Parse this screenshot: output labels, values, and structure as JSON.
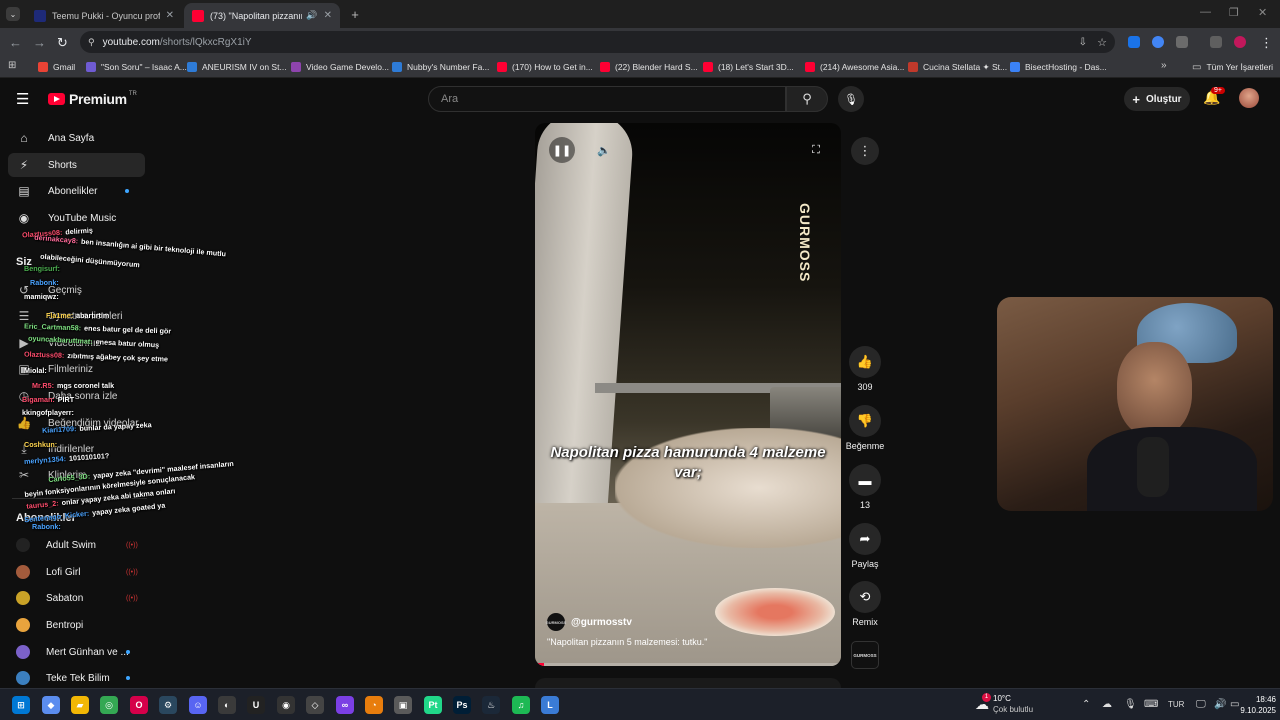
{
  "browser": {
    "tabs": [
      {
        "title": "Teemu Pukki - Oyuncu profili 2...",
        "active": false,
        "favicon_color": "#1e2a78"
      },
      {
        "title": "(73) \"Napolitan pizzanın 5 m...",
        "active": true,
        "favicon_color": "#ff0033"
      }
    ],
    "url_host": "youtube.com",
    "url_path": "/shorts/lQkxcRgX1iY",
    "new_tab": "+",
    "bookmarks": [
      {
        "label": "Gmail",
        "color": "#ea4335"
      },
      {
        "label": "\"Son Soru\" – Isaac A...",
        "color": "#6f5bd3"
      },
      {
        "label": "ANEURISM IV on St...",
        "color": "#2e7bd6"
      },
      {
        "label": "Video Game Develo...",
        "color": "#8e44ad"
      },
      {
        "label": "Nubby's Number Fa...",
        "color": "#2e7bd6"
      },
      {
        "label": "(170) How to Get in...",
        "color": "#ff0033"
      },
      {
        "label": "(22) Blender Hard S...",
        "color": "#ff0033"
      },
      {
        "label": "(18) Let's Start 3D...",
        "color": "#ff0033"
      },
      {
        "label": "(214) Awesome Asia...",
        "color": "#ff0033"
      },
      {
        "label": "Cucina Stellata ✦ St...",
        "color": "#c0392b"
      },
      {
        "label": "BisectHosting - Das...",
        "color": "#3b82f6"
      }
    ],
    "all_bookmarks": "Tüm Yer İşaretleri"
  },
  "masthead": {
    "brand": "Premium",
    "country": "TR",
    "search_placeholder": "Ara",
    "create_label": "Oluştur",
    "notif_count": "9+"
  },
  "sidebar": {
    "main": [
      {
        "label": "Ana Sayfa",
        "icon": "home-icon",
        "glyph": "⌂"
      },
      {
        "label": "Shorts",
        "icon": "shorts-icon",
        "glyph": "⚡"
      },
      {
        "label": "Abonelikler",
        "icon": "subscriptions-icon",
        "glyph": "▤"
      },
      {
        "label": "YouTube Music",
        "icon": "music-icon",
        "glyph": "◉"
      }
    ],
    "you_header": "Siz",
    "you": [
      {
        "label": "Geçmiş",
        "icon": "history-icon",
        "glyph": "↺"
      },
      {
        "label": "Oynatma listeleri",
        "icon": "playlist-icon",
        "glyph": "☰"
      },
      {
        "label": "Videolarınız",
        "icon": "your-videos-icon",
        "glyph": "▶"
      },
      {
        "label": "Filmleriniz",
        "icon": "movies-icon",
        "glyph": "▣"
      },
      {
        "label": "Daha sonra izle",
        "icon": "watch-later-icon",
        "glyph": "◷"
      },
      {
        "label": "Beğendiğim videolar",
        "icon": "liked-icon",
        "glyph": "👍"
      },
      {
        "label": "İndirilenler",
        "icon": "downloads-icon",
        "glyph": "⤓"
      },
      {
        "label": "Kliplerim",
        "icon": "clips-icon",
        "glyph": "✂"
      }
    ],
    "subs_header": "Abonelikler",
    "subscriptions": [
      {
        "label": "Adult Swim",
        "color": "#222222",
        "live": true,
        "dot": false
      },
      {
        "label": "Lofi Girl",
        "color": "#a35b3c",
        "live": true,
        "dot": false
      },
      {
        "label": "Sabaton",
        "color": "#c9a227",
        "live": true,
        "dot": false
      },
      {
        "label": "Bentropi",
        "color": "#e8a33d",
        "live": false,
        "dot": false
      },
      {
        "label": "Mert Günhan ve ...",
        "color": "#7b61c9",
        "live": false,
        "dot": true
      },
      {
        "label": "Teke Tek Bilim",
        "color": "#3b7fbf",
        "live": false,
        "dot": true
      }
    ]
  },
  "chat": [
    {
      "user": "Olaztuss08:",
      "msg": "delirmiş",
      "color": "#ff4d6d"
    },
    {
      "user": "derinakcay8:",
      "msg": "ben insanlığın ai gibi bir teknoloji ile mutlu",
      "color": "#ff6b9a"
    },
    {
      "user": "",
      "msg": "olabileceğini düşünmüyorum",
      "color": "#ffffff"
    },
    {
      "user": "Bengisurf:",
      "msg": "",
      "color": "#4caf50"
    },
    {
      "user": "Rabonk:",
      "msg": "",
      "color": "#4aa3ff"
    },
    {
      "user": "mamiqwz:",
      "msg": "",
      "color": "#ffffff"
    },
    {
      "user": "Fla1me:",
      "msg": "abartırtım",
      "color": "#ffd54f"
    },
    {
      "user": "Eric_Cartman58:",
      "msg": "enes batur gel de deli gör",
      "color": "#7ee081"
    },
    {
      "user": "oyuncakbaruttmat:",
      "msg": "enesa batur olmuş",
      "color": "#7ee081"
    },
    {
      "user": "Olaztuss08:",
      "msg": "zıbıtmış ağabey çok şey etme",
      "color": "#ff4d6d"
    },
    {
      "user": "Miolal:",
      "msg": "",
      "color": "#ffffff"
    },
    {
      "user": "Mr.R5:",
      "msg": "mgs coronel talk",
      "color": "#ff4d6d"
    },
    {
      "user": "Bigaman:",
      "msg": "PİRT",
      "color": "#ff4d6d"
    },
    {
      "user": "kkingofplayerr:",
      "msg": "",
      "color": "#ffffff"
    },
    {
      "user": "Kiari1709:",
      "msg": "bunlar da yapay zeka",
      "color": "#4aa3ff"
    },
    {
      "user": "Coshkun:",
      "msg": "",
      "color": "#ffd54f"
    },
    {
      "user": "merlyn1354:",
      "msg": "101010101?",
      "color": "#4aa3ff"
    },
    {
      "user": "Carlo55_3D:",
      "msg": "yapay zeka \"devrimi\" maalesef insanların",
      "color": "#7ee081"
    },
    {
      "user": "",
      "msg": "beyin fonksiyonlarının körelmesiyle sonuçlanacak",
      "color": "#ffffff"
    },
    {
      "user": "taurus_2:",
      "msg": "onlar yapay zeka abi takma onları",
      "color": "#ff4d6d"
    },
    {
      "user": "Sentenago_Kicker:",
      "msg": "yapay zeka goated ya",
      "color": "#4aa3ff"
    },
    {
      "user": "Rabonk:",
      "msg": "",
      "color": "#4aa3ff"
    }
  ],
  "short": {
    "brand_mark": "GURMOSS",
    "caption": "Napolitan pizza hamurunda 4 malzeme var;",
    "channel": "@gurmosstv",
    "channel_avatar_text": "GURMOSS",
    "title": "\"Napolitan pizzanın 5 malzemesi: tutku.\"",
    "progress": 0.03
  },
  "actions": {
    "likes": "309",
    "dislike": "Beğenme",
    "comments": "13",
    "share": "Paylaş",
    "remix": "Remix",
    "sound_thumb": "GURMOSS"
  },
  "taskbar": {
    "apps": [
      {
        "name": "windows-start",
        "glyph": "⊞",
        "color": "#0078d4"
      },
      {
        "name": "copilot",
        "glyph": "◆",
        "color": "#5b8def"
      },
      {
        "name": "explorer",
        "glyph": "▰",
        "color": "#f2b705"
      },
      {
        "name": "chrome",
        "glyph": "◎",
        "color": "#34a853"
      },
      {
        "name": "opera-gx",
        "glyph": "O",
        "color": "#d5004a"
      },
      {
        "name": "steam-app",
        "glyph": "⚙",
        "color": "#2a475e"
      },
      {
        "name": "discord",
        "glyph": "☺",
        "color": "#5865f2"
      },
      {
        "name": "obs",
        "glyph": "◐",
        "color": "#3a3a3a"
      },
      {
        "name": "unreal",
        "glyph": "U",
        "color": "#222222"
      },
      {
        "name": "github",
        "glyph": "◉",
        "color": "#333333"
      },
      {
        "name": "unity",
        "glyph": "◇",
        "color": "#444444"
      },
      {
        "name": "visual-studio",
        "glyph": "∞",
        "color": "#7b3fe4"
      },
      {
        "name": "blender",
        "glyph": "◔",
        "color": "#e87d0d"
      },
      {
        "name": "app",
        "glyph": "▣",
        "color": "#5a5a5a"
      },
      {
        "name": "pycharm",
        "glyph": "Pt",
        "color": "#21d789"
      },
      {
        "name": "photoshop",
        "glyph": "Ps",
        "color": "#001e36"
      },
      {
        "name": "steam",
        "glyph": "♨",
        "color": "#1b2838"
      },
      {
        "name": "spotify",
        "glyph": "♫",
        "color": "#1db954"
      },
      {
        "name": "editor",
        "glyph": "L",
        "color": "#3a7bd5"
      }
    ],
    "weather_temp": "10°C",
    "weather_desc": "Çok bulutlu",
    "weather_badge": "1",
    "lang": "TUR",
    "time": "18:46",
    "date": "9.10.2025"
  }
}
